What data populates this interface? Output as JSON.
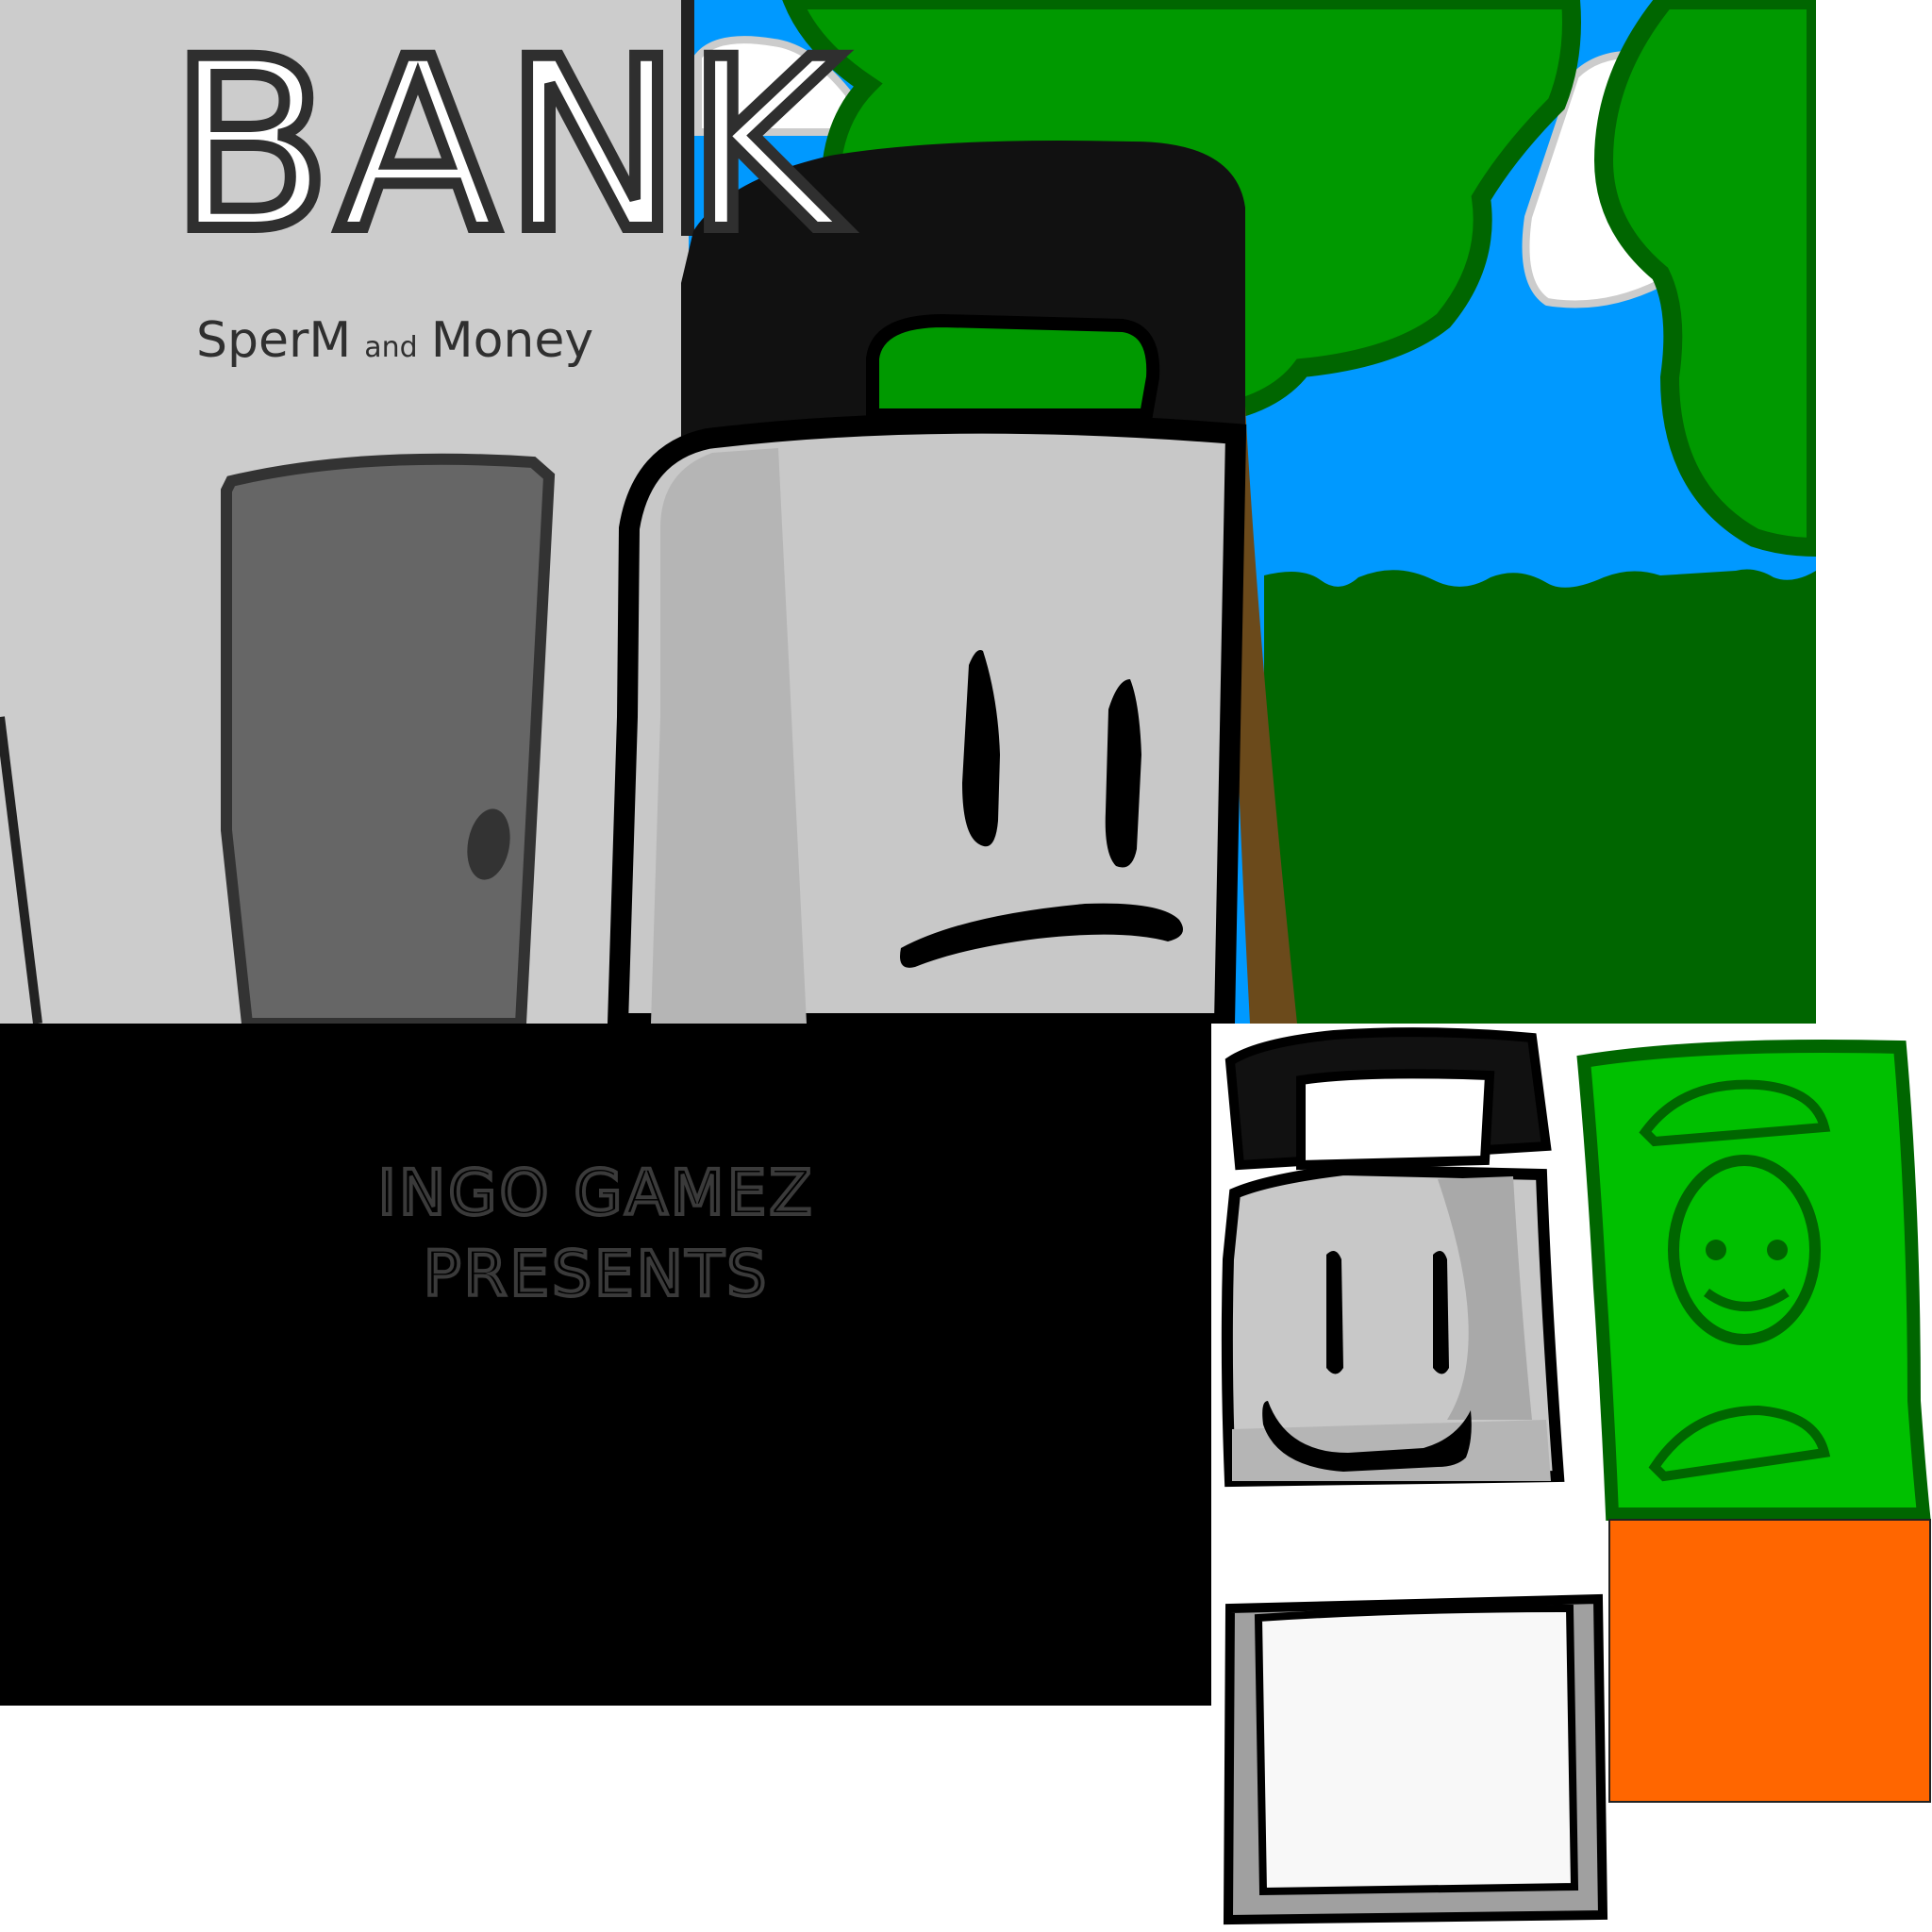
{
  "scene": {
    "bank_title": "BANK",
    "bank_subtitle_1": "SperM",
    "bank_subtitle_and": "and",
    "bank_subtitle_2": "Money"
  },
  "intro": {
    "line1": "INGO GAMEZ",
    "line2": "PRESENTS"
  },
  "colors": {
    "sky": "#0099ff",
    "tree": "#009900",
    "tree_dark": "#006600",
    "wall": "#cccccc",
    "door": "#666666",
    "character_body": "#c8c8c8",
    "handle": "#111111",
    "money": "#00c000",
    "orange": "#ff6600",
    "intro_bg": "#000000",
    "intro_text": "#3a3a3a"
  },
  "icons": [
    "bank-door-icon",
    "briefcase-character-icon",
    "money-bill-icon",
    "blank-card-icon"
  ]
}
